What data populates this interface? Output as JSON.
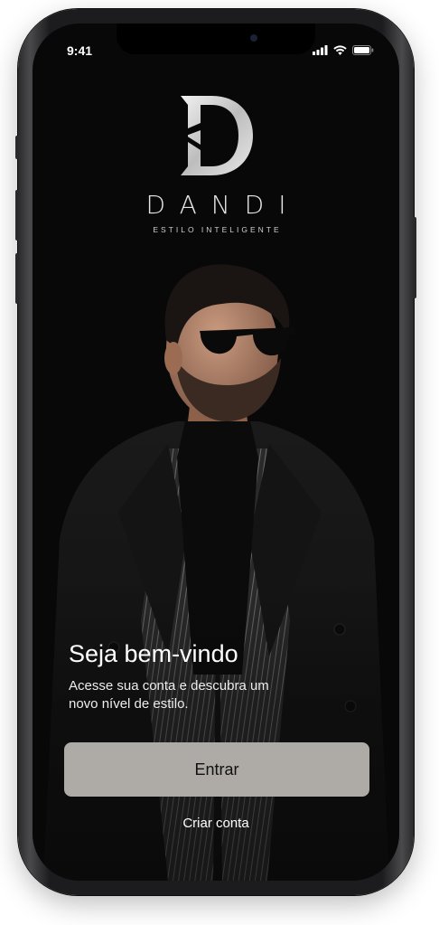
{
  "status_bar": {
    "time": "9:41",
    "icons": [
      "signal-icon",
      "wifi-icon",
      "battery-icon"
    ]
  },
  "brand": {
    "monogram": "D",
    "name": "DANDI",
    "tagline": "ESTILO INTELIGENTE"
  },
  "hero": {
    "image": "man-in-black-coat-with-sunglasses"
  },
  "welcome": {
    "title": "Seja bem-vindo",
    "subtitle": "Acesse sua conta e descubra um novo nível de estilo."
  },
  "actions": {
    "primary_label": "Entrar",
    "secondary_label": "Criar conta"
  },
  "colors": {
    "background": "#080808",
    "button": "#aeaba7",
    "text": "#ffffff"
  }
}
